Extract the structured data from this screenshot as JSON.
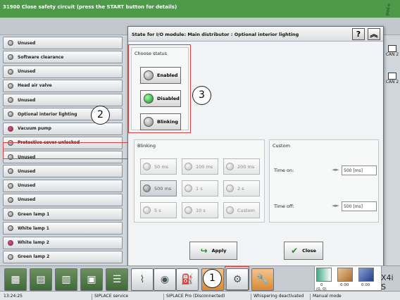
{
  "topbar": {
    "message": "31900 Close safety circuit (press the START button for details)",
    "info_glyph": "i"
  },
  "left_list": [
    {
      "label": "Unused",
      "led": "gray"
    },
    {
      "label": "Software clearance",
      "led": "gray"
    },
    {
      "label": "Unused",
      "led": "gray"
    },
    {
      "label": "Head air valve",
      "led": "gray"
    },
    {
      "label": "Unused",
      "led": "gray"
    },
    {
      "label": "Optional interior lighting",
      "led": "gray"
    },
    {
      "label": "Vacuum pump",
      "led": "red"
    },
    {
      "label": "Protective cover unlocked",
      "led": "gray"
    },
    {
      "label": "Unused",
      "led": "gray"
    },
    {
      "label": "Unused",
      "led": "gray"
    },
    {
      "label": "Unused",
      "led": "gray"
    },
    {
      "label": "Unused",
      "led": "gray"
    },
    {
      "label": "Green lamp 1",
      "led": "gray"
    },
    {
      "label": "White lamp 1",
      "led": "gray"
    },
    {
      "label": "White lamp 2",
      "led": "red"
    },
    {
      "label": "Green lamp 2",
      "led": "gray"
    }
  ],
  "right_side": {
    "tab1": "CAN 2",
    "tab2": "CAN 2"
  },
  "dialog": {
    "title": "State for I/O module: Main distributor : Optional interior lighting",
    "help_glyph": "?",
    "collapse_glyph": "︽",
    "choose_status": {
      "title": "Choose status",
      "enabled": "Enabled",
      "disabled": "Disabled",
      "blinking": "Blinking"
    },
    "blinking": {
      "title": "Blinking",
      "options": [
        "50 ms",
        "100 ms",
        "200 ms",
        "500 ms",
        "1 s",
        "2 s",
        "5 s",
        "10 s",
        "Custom"
      ]
    },
    "custom": {
      "title": "Custom",
      "time_on_label": "Time on:",
      "time_on_value": "500 [ms]",
      "time_off_label": "Time off:",
      "time_off_value": "500 [ms]"
    },
    "apply_label": "Apply",
    "close_label": "Close"
  },
  "callouts": {
    "one": "1",
    "two": "2",
    "three": "3"
  },
  "counters": {
    "c1": "0",
    "c1_sub": "(0, 0)",
    "c2": "0.00",
    "c3": "0.00"
  },
  "machine": "X4i S",
  "status_bar": {
    "time": "13:24:25",
    "service": "SIPLACE service",
    "pro": "SIPLACE Pro (Disconnected)",
    "whisper": "Whispering deactivated",
    "mode": "Manual mode"
  }
}
